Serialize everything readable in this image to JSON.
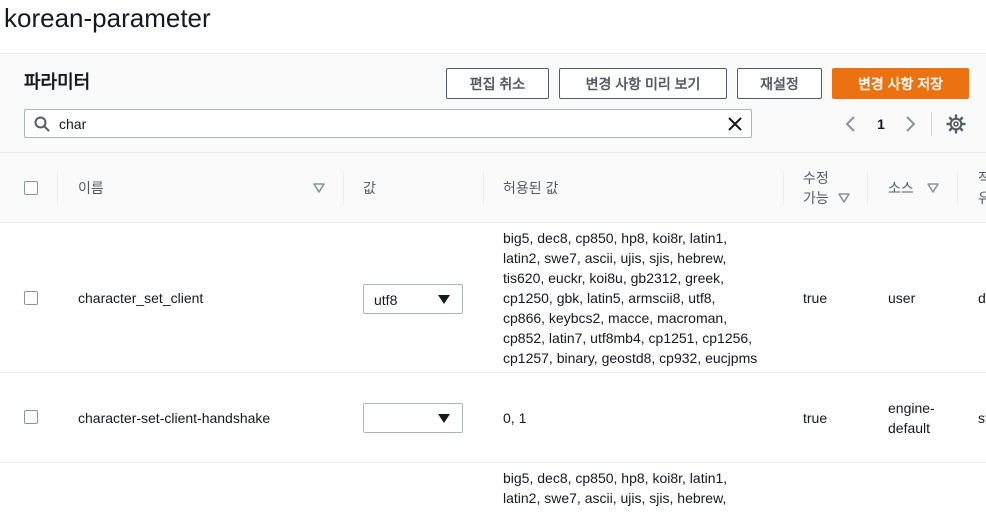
{
  "page": {
    "title": "korean-parameter"
  },
  "panel": {
    "title": "파라미터",
    "buttons": {
      "cancel_edit": "편집 취소",
      "preview_changes": "변경 사항 미리 보기",
      "reset": "재설정",
      "save_changes": "변경 사항 저장"
    }
  },
  "search": {
    "value": "char",
    "placeholder": ""
  },
  "pagination": {
    "current_page": "1"
  },
  "table": {
    "columns": {
      "name": "이름",
      "value": "값",
      "allowed_values": "허용된 값",
      "modifiable_line1": "수정",
      "modifiable_line2": "가능",
      "source": "소스",
      "next_line1": "적",
      "next_line2": "유"
    },
    "rows": [
      {
        "name": "character_set_client",
        "value": "utf8",
        "allowed_lines": [
          "big5, dec8, cp850, hp8, koi8r, latin1,",
          "latin2, swe7, ascii, ujis, sjis, hebrew,",
          "tis620, euckr, koi8u, gb2312, greek,",
          "cp1250, gbk, latin5, armscii8, utf8,",
          "cp866, keybcs2, macce, macroman,",
          "cp852, latin7, utf8mb4, cp1251, cp1256,",
          "cp1257, binary, geostd8, cp932, eucjpms"
        ],
        "modifiable": "true",
        "source": "user",
        "next_partial": "d"
      },
      {
        "name": "character-set-client-handshake",
        "value": "",
        "allowed_lines": [
          "0, 1"
        ],
        "modifiable": "true",
        "source_line1": "engine-",
        "source_line2": "default",
        "next_partial": "st"
      },
      {
        "allowed_lines": [
          "big5, dec8, cp850, hp8, koi8r, latin1,",
          "latin2, swe7, ascii, ujis, sjis, hebrew,"
        ]
      }
    ]
  },
  "colors": {
    "primary": "#ec7211",
    "text": "#16191f",
    "muted": "#545b64",
    "border": "#eaeded"
  }
}
